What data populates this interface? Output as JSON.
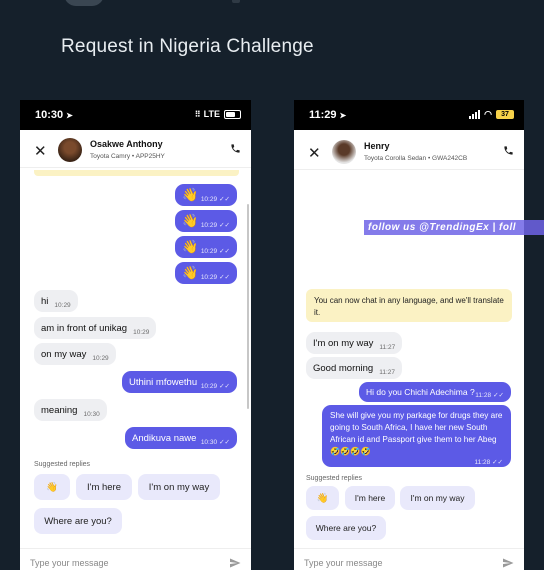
{
  "page_title": "Request in Nigeria Challenge",
  "watermark": "follow us @TrendingEx | foll",
  "left_phone": {
    "status_time": "10:30",
    "status_network": "LTE",
    "driver_name": "Osakwe Anthony",
    "car_info": "Toyota Camry • APP25HY",
    "messages": [
      {
        "dir": "out",
        "text": "👋",
        "time": "10:29"
      },
      {
        "dir": "out",
        "text": "👋",
        "time": "10:29"
      },
      {
        "dir": "out",
        "text": "👋",
        "time": "10:29"
      },
      {
        "dir": "out",
        "text": "👋",
        "time": "10:29"
      },
      {
        "dir": "in",
        "text": "hi",
        "time": "10:29"
      },
      {
        "dir": "in",
        "text": "am in front of unikag",
        "time": "10:29"
      },
      {
        "dir": "in",
        "text": "on my way",
        "time": "10:29"
      },
      {
        "dir": "out",
        "text": "Uthini mfowethu",
        "time": "10:29"
      },
      {
        "dir": "in",
        "text": "meaning",
        "time": "10:30"
      },
      {
        "dir": "out",
        "text": "Andikuva nawe",
        "time": "10:30"
      }
    ],
    "suggested_label": "Suggested replies",
    "suggestions": [
      "👋",
      "I'm here",
      "I'm on my way",
      "Where are you?"
    ],
    "input_placeholder": "Type your message"
  },
  "right_phone": {
    "status_time": "11:29",
    "battery": "37",
    "driver_name": "Henry",
    "car_info": "Toyota Corolla Sedan • GWA242CB",
    "notice": "You can now chat in any language, and we'll translate it.",
    "messages": [
      {
        "dir": "in",
        "text": "I'm on my way",
        "time": "11:27"
      },
      {
        "dir": "in",
        "text": "Good morning",
        "time": "11:27"
      },
      {
        "dir": "out",
        "text": "Hi do you Chichi Adechima ?",
        "time": "11:28"
      },
      {
        "dir": "out",
        "text": "She will give you my parkage for drugs they are going to South Africa, I have her new South African id and Passport give them to her Abeg 🤣🤣🤣🤣",
        "time": "11:28"
      }
    ],
    "suggested_label": "Suggested replies",
    "suggestions": [
      "👋",
      "I'm here",
      "I'm on my way",
      "Where are you?"
    ],
    "input_placeholder": "Type your message"
  }
}
